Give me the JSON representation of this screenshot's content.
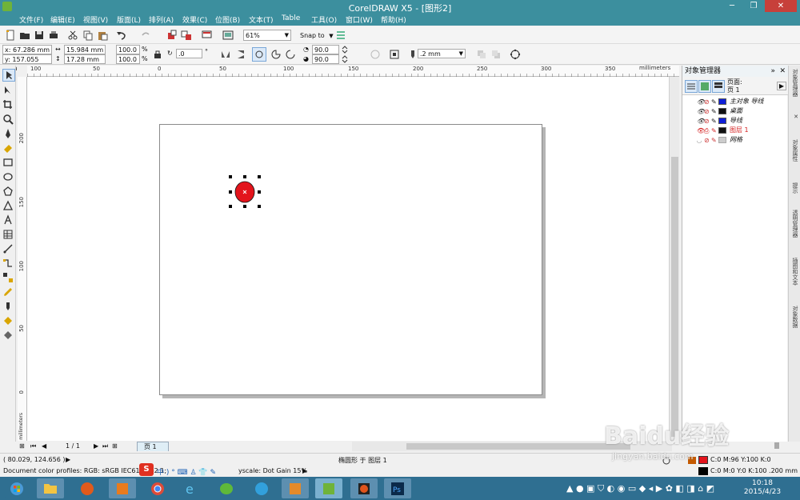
{
  "window": {
    "title": "CorelDRAW X5 - [图形2]",
    "minimize": "─",
    "restore": "❐",
    "close": "✕"
  },
  "menu": [
    "文件(F)",
    "编辑(E)",
    "视图(V)",
    "版面(L)",
    "排列(A)",
    "效果(C)",
    "位图(B)",
    "文本(T)",
    "Table",
    "工具(O)",
    "窗口(W)",
    "帮助(H)"
  ],
  "toolbar": {
    "zoom": "61%",
    "snap_to": "Snap to"
  },
  "propbar": {
    "x": "x: 67.286 mm",
    "y": "y: 157.055 mm",
    "width": "15.984 mm",
    "height": "17.28 mm",
    "scale_x": "100.0",
    "scale_y": "100.0",
    "percent": "%",
    "rotation": ".0",
    "degree": "°",
    "start_angle": "90.0",
    "end_angle": "90.0",
    "outline": ".2 mm"
  },
  "ruler": {
    "unit": "millimeters",
    "top_labels": [
      "100",
      "50",
      "0",
      "50",
      "100",
      "150",
      "200",
      "250",
      "300",
      "350"
    ],
    "left_labels": [
      "200",
      "150",
      "100",
      "50",
      "0"
    ],
    "left_unit": "millimeters"
  },
  "pagenav": {
    "counter": "1 / 1",
    "page_tab": "页 1"
  },
  "status": {
    "coords": "( 80.029, 124.656 )",
    "selection": "椭圆形 于 图层 1",
    "color_profile": "Document color profiles: RGB: sRGB IEC61966-2.1; ",
    "grayscale": "yscale: Dot Gain 15%",
    "fill": "C:0 M:96 Y:100 K:0",
    "outline": "C:0 M:0 Y:0 K:100  .200 mm"
  },
  "objmgr": {
    "title": "对象管理器",
    "page_label": "页面:",
    "page_name": "页 1",
    "layers": [
      {
        "name": "主对象 导线",
        "color": "#1020d8"
      },
      {
        "name": "桌面",
        "color": "#111111"
      },
      {
        "name": "导线",
        "color": "#1020d8"
      },
      {
        "name": "图层 1",
        "color": "#111111"
      },
      {
        "name": "网格",
        "color": "#cccccc"
      }
    ]
  },
  "dock_tabs": [
    "对象管理器",
    "对象属性",
    "提示",
    "透明管理器",
    "插图和文本",
    "对象数据"
  ],
  "clock": {
    "time": "10:18",
    "date": "2015/4/23"
  },
  "watermark": "Baidu经验",
  "watermark_sub": "jingyan.baidu.com",
  "colors": {
    "titlebar": "#3c8f9e",
    "ellipse_fill": "#e3141c",
    "taskbar": "#2f6f91",
    "active_layer": "#d42020"
  }
}
